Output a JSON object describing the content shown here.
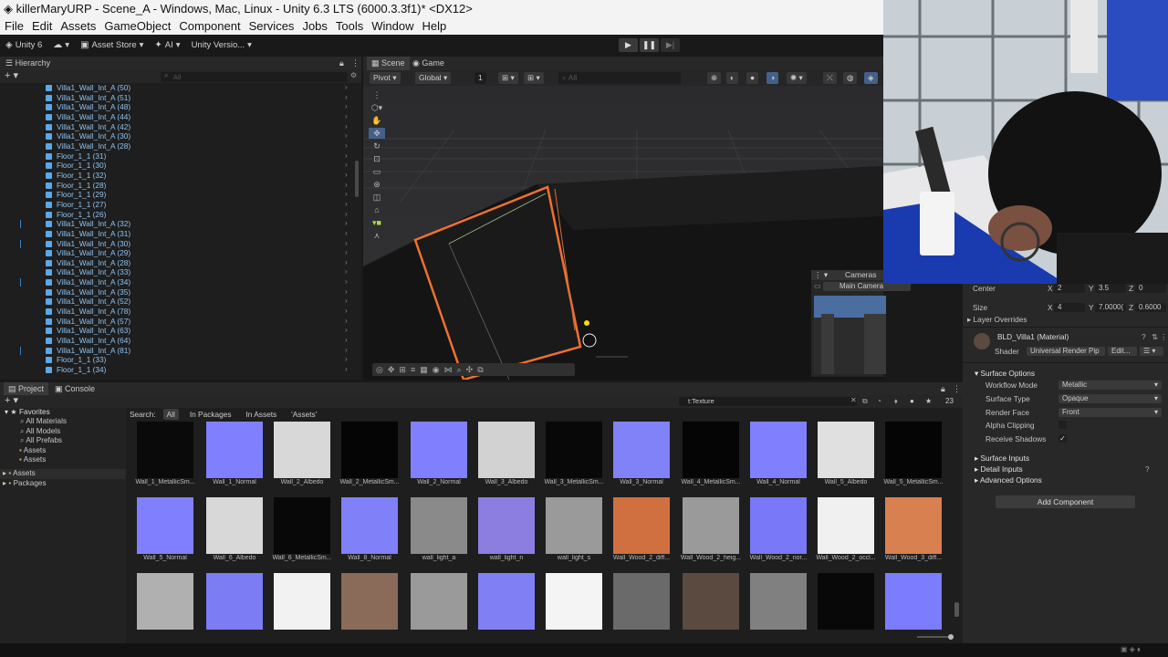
{
  "window": {
    "title": "killerMaryURP - Scene_A - Windows, Mac, Linux - Unity 6.3 LTS (6000.3.3f1)* <DX12>"
  },
  "menu": [
    "File",
    "Edit",
    "Assets",
    "GameObject",
    "Component",
    "Services",
    "Jobs",
    "Tools",
    "Window",
    "Help"
  ],
  "toolbar": {
    "account": "Unity 6",
    "asset_store": "Asset Store",
    "ai": "AI",
    "version": "Unity Versio..."
  },
  "play": {
    "play_icon": "▶",
    "pause_icon": "❚❚",
    "step_icon": "▶|"
  },
  "hierarchy": {
    "title": "Hierarchy",
    "search_placeholder": "All",
    "items": [
      {
        "label": "Villa1_Wall_Int_A (50)",
        "mark": false
      },
      {
        "label": "Villa1_Wall_Int_A (51)",
        "mark": false
      },
      {
        "label": "Villa1_Wall_Int_A (48)",
        "mark": false
      },
      {
        "label": "Villa1_Wall_Int_A (44)",
        "mark": false
      },
      {
        "label": "Villa1_Wall_Int_A (42)",
        "mark": false
      },
      {
        "label": "Villa1_Wall_Int_A (30)",
        "mark": false
      },
      {
        "label": "Villa1_Wall_Int_A (28)",
        "mark": false
      },
      {
        "label": "Floor_1_1 (31)",
        "mark": false
      },
      {
        "label": "Floor_1_1 (30)",
        "mark": false
      },
      {
        "label": "Floor_1_1 (32)",
        "mark": false
      },
      {
        "label": "Floor_1_1 (28)",
        "mark": false
      },
      {
        "label": "Floor_1_1 (29)",
        "mark": false
      },
      {
        "label": "Floor_1_1 (27)",
        "mark": false
      },
      {
        "label": "Floor_1_1 (26)",
        "mark": false
      },
      {
        "label": "Villa1_Wall_Int_A (32)",
        "mark": true
      },
      {
        "label": "Villa1_Wall_Int_A (31)",
        "mark": false
      },
      {
        "label": "Villa1_Wall_Int_A (30)",
        "mark": true
      },
      {
        "label": "Villa1_Wall_Int_A (29)",
        "mark": false
      },
      {
        "label": "Villa1_Wall_Int_A (28)",
        "mark": false
      },
      {
        "label": "Villa1_Wall_Int_A (33)",
        "mark": false
      },
      {
        "label": "Villa1_Wall_Int_A (34)",
        "mark": true
      },
      {
        "label": "Villa1_Wall_Int_A (35)",
        "mark": false
      },
      {
        "label": "Villa1_Wall_Int_A (52)",
        "mark": false
      },
      {
        "label": "Villa1_Wall_Int_A (78)",
        "mark": false
      },
      {
        "label": "Villa1_Wall_Int_A (57)",
        "mark": false
      },
      {
        "label": "Villa1_Wall_Int_A (63)",
        "mark": false
      },
      {
        "label": "Villa1_Wall_Int_A (64)",
        "mark": false
      },
      {
        "label": "Villa1_Wall_Int_A (81)",
        "mark": true
      },
      {
        "label": "Floor_1_1 (33)",
        "mark": false
      },
      {
        "label": "Floor_1_1 (34)",
        "mark": false
      }
    ]
  },
  "scene": {
    "tab_scene": "Scene",
    "tab_game": "Game",
    "pivot": "Pivot",
    "global": "Global",
    "grid_value": "1",
    "search_placeholder": "All",
    "cameras_overlay": "Cameras",
    "main_camera": "Main Camera"
  },
  "project": {
    "tab_project": "Project",
    "tab_console": "Console",
    "search_value": "t:Texture",
    "count": "23",
    "favorites_label": "Favorites",
    "favorites": [
      "All Materials",
      "All Models",
      "All Prefabs",
      "Assets",
      "Assets"
    ],
    "roots": [
      "Assets",
      "Packages"
    ],
    "search_label": "Search:",
    "filters": [
      "All",
      "In Packages",
      "In Assets",
      "'Assets'"
    ],
    "row1": [
      {
        "label": "Wall_1_MetallicSm...",
        "color": "#0a0a0a"
      },
      {
        "label": "Wall_1_Normal",
        "color": "#8080ff"
      },
      {
        "label": "Wall_2_Albedo",
        "color": "#d8d8d8"
      },
      {
        "label": "Wall_2_MetallicSm...",
        "color": "#050505"
      },
      {
        "label": "Wall_2_Normal",
        "color": "#8080ff"
      },
      {
        "label": "Wall_3_Albedo",
        "color": "#d2d2d2"
      },
      {
        "label": "Wall_3_MetallicSm...",
        "color": "#080808"
      },
      {
        "label": "Wall_3_Normal",
        "color": "#8282f8"
      },
      {
        "label": "Wall_4_MetallicSm...",
        "color": "#050505"
      },
      {
        "label": "Wall_4_Normal",
        "color": "#8080ff"
      },
      {
        "label": "Wall_5_Albedo",
        "color": "#e0e0e0"
      },
      {
        "label": "Wall_5_MetallicSm...",
        "color": "#050505"
      }
    ],
    "row2": [
      {
        "label": "Wall_5_Normal",
        "color": "#8080ff"
      },
      {
        "label": "Wall_6_Albedo",
        "color": "#d8d8d8"
      },
      {
        "label": "Wall_6_MetallicSm...",
        "color": "#080808"
      },
      {
        "label": "Wall_8_Normal",
        "color": "#8080f8"
      },
      {
        "label": "wall_light_a",
        "color": "#8a8a8a"
      },
      {
        "label": "wall_light_n",
        "color": "#8c7ee0"
      },
      {
        "label": "wall_light_s",
        "color": "#9a9a9a"
      },
      {
        "label": "Wall_Wood_2_diff...",
        "color": "#d07040"
      },
      {
        "label": "Wall_Wood_2_heig...",
        "color": "#9a9a9a"
      },
      {
        "label": "Wall_Wood_2_nor...",
        "color": "#7878f8"
      },
      {
        "label": "Wall_Wood_2_occl...",
        "color": "#f0f0f0"
      },
      {
        "label": "Wall_Wood_3_diff...",
        "color": "#d88050"
      }
    ],
    "row3": [
      {
        "color": "#b0b0b0"
      },
      {
        "color": "#7c7cf4"
      },
      {
        "color": "#f2f2f2"
      },
      {
        "color": "#8a6a58"
      },
      {
        "color": "#9a9a9a"
      },
      {
        "color": "#8080f4"
      },
      {
        "color": "#f4f4f4"
      },
      {
        "color": "#6a6a6a"
      },
      {
        "color": "#5a4a40"
      },
      {
        "color": "#808080"
      },
      {
        "color": "#080808"
      },
      {
        "color": "#7c7cff"
      }
    ]
  },
  "inspector": {
    "center_label": "Center",
    "size_label": "Size",
    "center": {
      "x": "2",
      "y": "3.5",
      "z": "0"
    },
    "size": {
      "x": "4",
      "y": "7.0000(",
      "z": "0.6000"
    },
    "layer_overrides": "Layer Overrides",
    "material_name": "BLD_Villa1 (Material)",
    "shader_label": "Shader",
    "shader_value": "Universal Render Pip",
    "edit": "Edit...",
    "surface_options": "Surface Options",
    "props": [
      {
        "label": "Workflow Mode",
        "value": "Metallic"
      },
      {
        "label": "Surface Type",
        "value": "Opaque"
      },
      {
        "label": "Render Face",
        "value": "Front"
      }
    ],
    "alpha_clipping": "Alpha Clipping",
    "receive_shadows": "Receive Shadows",
    "surface_inputs": "Surface Inputs",
    "detail_inputs": "Detail Inputs",
    "advanced_options": "Advanced Options",
    "add_component": "Add Component"
  }
}
